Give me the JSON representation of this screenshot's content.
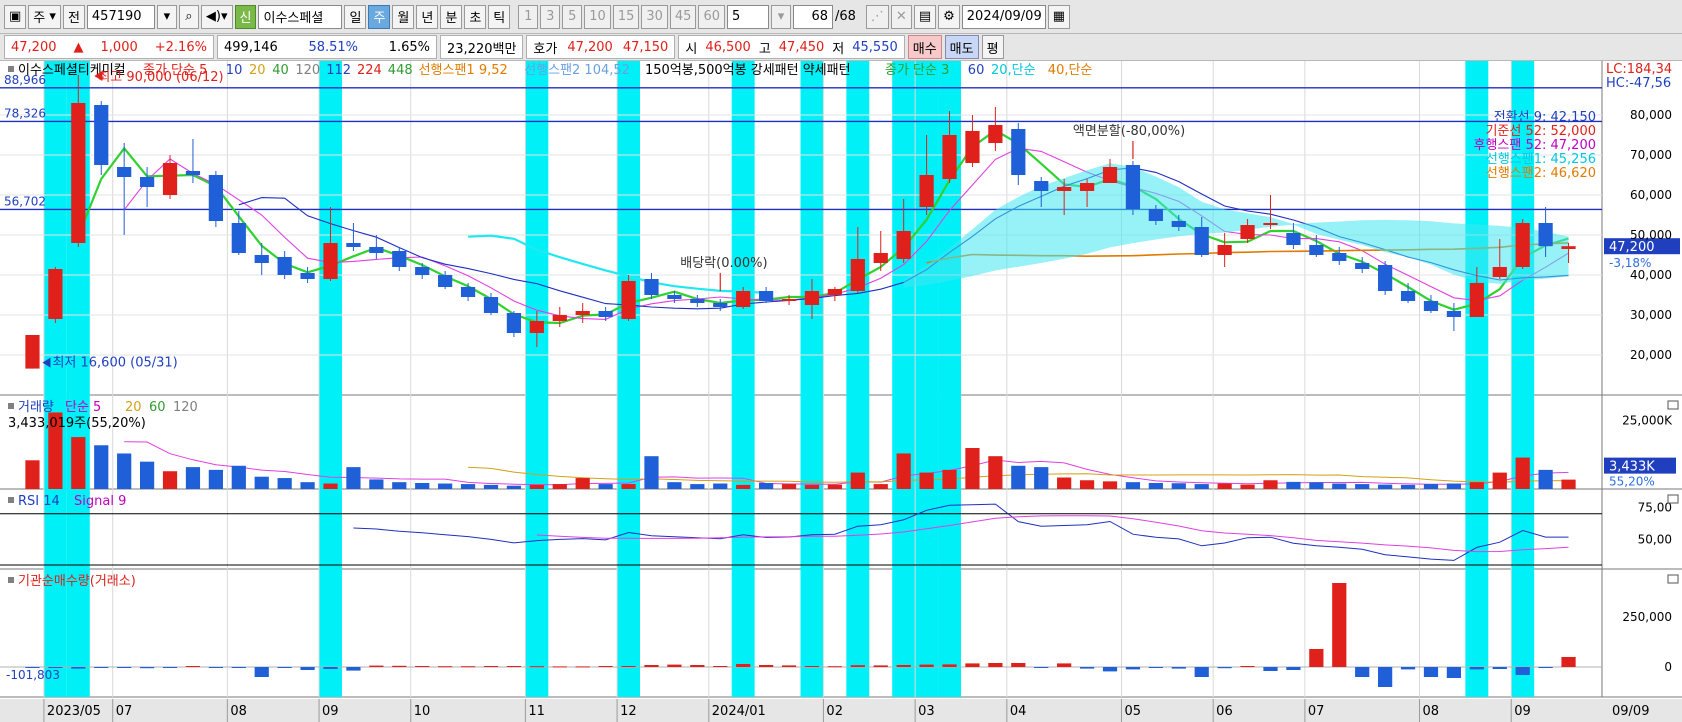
{
  "toolbar": {
    "type_select": "주",
    "prev_label": "전",
    "code": "457190",
    "search_icon": "search-icon",
    "sound_icon": "speaker-icon",
    "new_badge": "신",
    "stock_name": "이수스페셜",
    "periods": [
      "일",
      "주",
      "월",
      "년",
      "분",
      "초",
      "틱"
    ],
    "active_period": "주",
    "intervals": [
      "1",
      "3",
      "5",
      "10",
      "15",
      "30",
      "45",
      "60"
    ],
    "interval_select": "5",
    "count": "68",
    "count_total": "/68",
    "date": "2024/09/09",
    "calendar_icon": "calendar-icon"
  },
  "info": {
    "price": "47,200",
    "change_arrow": "▲",
    "change": "1,000",
    "change_pct": "+2.16%",
    "volume": "499,146",
    "volume_pct": "58.51%",
    "turnover": "1.65%",
    "amount": "23,220백만",
    "quote_label": "호가",
    "ask": "47,200",
    "bid": "47,150",
    "open_label": "시",
    "open": "46,500",
    "high_label": "고",
    "high": "47,450",
    "low_label": "저",
    "low": "45,550",
    "buy_label": "매수",
    "sell_label": "매도",
    "avg_label": "평"
  },
  "chart_data": {
    "type": "candlestick",
    "periodicity": "weekly",
    "price_axis": {
      "ylim": [
        12000,
        90000
      ],
      "ticks": [
        "80,000",
        "70,000",
        "60,000",
        "50,000",
        "40,000",
        "30,000",
        "20,000"
      ]
    },
    "price_legend": [
      {
        "text": "이수스페셜티케미컬",
        "color": "#000000"
      },
      {
        "text": "종가 단순 5",
        "color": "#e0201a"
      },
      {
        "text": "10",
        "color": "#1f3fbf"
      },
      {
        "text": "20",
        "color": "#d4a017"
      },
      {
        "text": "40",
        "color": "#2f9e2f"
      },
      {
        "text": "120",
        "color": "#808080"
      },
      {
        "text": "112",
        "color": "#1f3fbf"
      },
      {
        "text": "224",
        "color": "#e0201a"
      },
      {
        "text": "448",
        "color": "#2f9e2f"
      },
      {
        "text": "선행스팬1 9,52",
        "color": "#e07b00"
      },
      {
        "text": "선행스팬2 104,52",
        "color": "#6aa0e0"
      },
      {
        "text": "150억봉,500억봉 강세패턴  약세패턴",
        "color": "#000000"
      },
      {
        "text": "종가 단순 3",
        "color": "#2f9e2f"
      },
      {
        "text": "60",
        "color": "#1f3fbf"
      },
      {
        "text": "20,단순",
        "color": "#00c8e0"
      },
      {
        "text": "40,단순",
        "color": "#e07b00"
      }
    ],
    "hlines": [
      {
        "label": "88,966",
        "value": 86800
      },
      {
        "label": "78,326",
        "value": 78400
      },
      {
        "label": "56,702",
        "value": 56400
      }
    ],
    "annotations": {
      "high": "최고 90,000 (06/12)",
      "low": "최저 16,600 (05/31)",
      "dividend": "배당락(0.00%)",
      "split": "액면분할(-80,00%)"
    },
    "top_right_labels": {
      "lc": "LC:184,34",
      "hc": "HC:-47,56"
    },
    "right_side_labels": [
      {
        "text": "전환선 9: 42,150",
        "color": "#1f3fbf"
      },
      {
        "text": "기준선 52: 52,000",
        "color": "#e0201a"
      },
      {
        "text": "후행스팬 52: 47,200",
        "color": "#c000c0"
      },
      {
        "text": "선행스팬1: 45,256",
        "color": "#00c8e0"
      },
      {
        "text": "선행스팬2: 46,620",
        "color": "#e07b00"
      }
    ],
    "current_price_tag": "47,200",
    "current_change_tag": "-3,18%",
    "x_axis_labels": [
      {
        "label": "2023/05",
        "i": 1
      },
      {
        "label": "07",
        "i": 4
      },
      {
        "label": "08",
        "i": 9
      },
      {
        "label": "09",
        "i": 13
      },
      {
        "label": "10",
        "i": 17
      },
      {
        "label": "11",
        "i": 22
      },
      {
        "label": "12",
        "i": 26
      },
      {
        "label": "2024/01",
        "i": 30
      },
      {
        "label": "02",
        "i": 35
      },
      {
        "label": "03",
        "i": 39
      },
      {
        "label": "04",
        "i": 43
      },
      {
        "label": "05",
        "i": 48
      },
      {
        "label": "06",
        "i": 52
      },
      {
        "label": "07",
        "i": 56
      },
      {
        "label": "08",
        "i": 61
      },
      {
        "label": "09",
        "i": 65
      }
    ],
    "x_axis_end_label": "09/09",
    "highlight_weeks": [
      1,
      2,
      13,
      22,
      26,
      31,
      34,
      36,
      38,
      39,
      40,
      63,
      65
    ],
    "candles": [
      {
        "o": 16600,
        "h": 25000,
        "l": 16600,
        "c": 25000
      },
      {
        "o": 29000,
        "h": 42000,
        "l": 28000,
        "c": 41500
      },
      {
        "o": 48000,
        "h": 90000,
        "l": 47000,
        "c": 83000
      },
      {
        "o": 82500,
        "h": 83500,
        "l": 65000,
        "c": 67500
      },
      {
        "o": 67000,
        "h": 73000,
        "l": 50000,
        "c": 64500
      },
      {
        "o": 64500,
        "h": 67000,
        "l": 57000,
        "c": 62000
      },
      {
        "o": 60000,
        "h": 70000,
        "l": 59000,
        "c": 68000
      },
      {
        "o": 66000,
        "h": 74000,
        "l": 63000,
        "c": 65000
      },
      {
        "o": 65000,
        "h": 66000,
        "l": 52000,
        "c": 53500
      },
      {
        "o": 53000,
        "h": 56000,
        "l": 45000,
        "c": 45500
      },
      {
        "o": 45000,
        "h": 48000,
        "l": 40000,
        "c": 43000
      },
      {
        "o": 44500,
        "h": 46000,
        "l": 39000,
        "c": 40000
      },
      {
        "o": 40500,
        "h": 42000,
        "l": 38000,
        "c": 39000
      },
      {
        "o": 39000,
        "h": 57000,
        "l": 38500,
        "c": 48000
      },
      {
        "o": 48000,
        "h": 53000,
        "l": 46000,
        "c": 47000
      },
      {
        "o": 47000,
        "h": 50000,
        "l": 44000,
        "c": 45500
      },
      {
        "o": 46000,
        "h": 47000,
        "l": 41000,
        "c": 42000
      },
      {
        "o": 42000,
        "h": 43000,
        "l": 39000,
        "c": 40000
      },
      {
        "o": 40000,
        "h": 41000,
        "l": 36500,
        "c": 37000
      },
      {
        "o": 37000,
        "h": 38000,
        "l": 33500,
        "c": 34500
      },
      {
        "o": 34500,
        "h": 35500,
        "l": 30000,
        "c": 30500
      },
      {
        "o": 30500,
        "h": 31000,
        "l": 24500,
        "c": 25500
      },
      {
        "o": 25500,
        "h": 31000,
        "l": 22000,
        "c": 28500
      },
      {
        "o": 28500,
        "h": 32000,
        "l": 27000,
        "c": 30000
      },
      {
        "o": 30000,
        "h": 33000,
        "l": 28000,
        "c": 31000
      },
      {
        "o": 31000,
        "h": 32000,
        "l": 28500,
        "c": 29500
      },
      {
        "o": 29000,
        "h": 40000,
        "l": 28500,
        "c": 38500
      },
      {
        "o": 39000,
        "h": 40500,
        "l": 34000,
        "c": 35000
      },
      {
        "o": 35000,
        "h": 36000,
        "l": 33000,
        "c": 34000
      },
      {
        "o": 34000,
        "h": 35000,
        "l": 32000,
        "c": 33000
      },
      {
        "o": 33000,
        "h": 34000,
        "l": 31000,
        "c": 32000
      },
      {
        "o": 32000,
        "h": 37000,
        "l": 31500,
        "c": 36000
      },
      {
        "o": 36000,
        "h": 37000,
        "l": 33000,
        "c": 33500
      },
      {
        "o": 33500,
        "h": 35000,
        "l": 32500,
        "c": 34000
      },
      {
        "o": 32500,
        "h": 39000,
        "l": 29000,
        "c": 36000
      },
      {
        "o": 35000,
        "h": 37000,
        "l": 33500,
        "c": 36500
      },
      {
        "o": 36000,
        "h": 52000,
        "l": 35500,
        "c": 44000
      },
      {
        "o": 43000,
        "h": 51000,
        "l": 41000,
        "c": 45500
      },
      {
        "o": 44000,
        "h": 59000,
        "l": 43000,
        "c": 51000
      },
      {
        "o": 57000,
        "h": 75000,
        "l": 55000,
        "c": 65000
      },
      {
        "o": 64000,
        "h": 81000,
        "l": 63000,
        "c": 75000
      },
      {
        "o": 68000,
        "h": 80000,
        "l": 67000,
        "c": 76000
      },
      {
        "o": 73000,
        "h": 82000,
        "l": 71000,
        "c": 77500
      },
      {
        "o": 76500,
        "h": 78000,
        "l": 62500,
        "c": 65000
      },
      {
        "o": 63500,
        "h": 64500,
        "l": 57000,
        "c": 61000
      },
      {
        "o": 61000,
        "h": 64000,
        "l": 55000,
        "c": 62000
      },
      {
        "o": 61000,
        "h": 64000,
        "l": 57000,
        "c": 63000
      },
      {
        "o": 63000,
        "h": 69000,
        "l": 63000,
        "c": 67000
      },
      {
        "o": 67500,
        "h": 68500,
        "l": 55000,
        "c": 56500
      },
      {
        "o": 56500,
        "h": 57500,
        "l": 52500,
        "c": 53500
      },
      {
        "o": 53500,
        "h": 55000,
        "l": 51000,
        "c": 52000
      },
      {
        "o": 52000,
        "h": 54500,
        "l": 44500,
        "c": 45000
      },
      {
        "o": 45000,
        "h": 50500,
        "l": 42000,
        "c": 47500
      },
      {
        "o": 49000,
        "h": 54000,
        "l": 48000,
        "c": 52500
      },
      {
        "o": 52500,
        "h": 60000,
        "l": 51500,
        "c": 53000
      },
      {
        "o": 50500,
        "h": 53000,
        "l": 46500,
        "c": 47500
      },
      {
        "o": 47500,
        "h": 50000,
        "l": 44500,
        "c": 45000
      },
      {
        "o": 45500,
        "h": 47000,
        "l": 42500,
        "c": 43500
      },
      {
        "o": 43000,
        "h": 44500,
        "l": 40500,
        "c": 41500
      },
      {
        "o": 42500,
        "h": 43500,
        "l": 35000,
        "c": 36000
      },
      {
        "o": 36000,
        "h": 38000,
        "l": 33000,
        "c": 33500
      },
      {
        "o": 33500,
        "h": 35000,
        "l": 30500,
        "c": 31000
      },
      {
        "o": 31000,
        "h": 33000,
        "l": 26000,
        "c": 29500
      },
      {
        "o": 29500,
        "h": 42000,
        "l": 29500,
        "c": 38000
      },
      {
        "o": 39500,
        "h": 49000,
        "l": 39000,
        "c": 42000
      },
      {
        "o": 42000,
        "h": 54000,
        "l": 41500,
        "c": 53000
      },
      {
        "o": 53000,
        "h": 57000,
        "l": 44500,
        "c": 47200
      },
      {
        "o": 46500,
        "h": 48000,
        "l": 43000,
        "c": 47200
      }
    ],
    "volume_panel": {
      "legend": [
        {
          "text": "거래량",
          "color": "#1f3fbf"
        },
        {
          "text": "단순 5",
          "color": "#c000c0"
        },
        {
          "text": "20",
          "color": "#d4a017"
        },
        {
          "text": "60",
          "color": "#2f9e2f"
        },
        {
          "text": "120",
          "color": "#808080"
        }
      ],
      "annotation": "3,433,019주(55,20%)",
      "ylim": [
        0,
        30000
      ],
      "ticks": [
        "25,000K"
      ],
      "current_tag": "3,433K",
      "current_pct_tag": "55,20%",
      "values": [
        10500,
        28000,
        19000,
        16000,
        13000,
        10000,
        6500,
        8000,
        7000,
        8500,
        4500,
        4000,
        2500,
        2000,
        8000,
        3500,
        2500,
        2200,
        2000,
        1800,
        1500,
        1200,
        1500,
        1800,
        4000,
        1800,
        1800,
        12000,
        2500,
        1800,
        2000,
        1500,
        2200,
        1800,
        1500,
        1600,
        6000,
        1800,
        13000,
        6000,
        7000,
        15000,
        12000,
        8500,
        8000,
        4200,
        3200,
        2800,
        2500,
        2200,
        2100,
        1800,
        2000,
        1600,
        3200,
        2600,
        2400,
        2000,
        1800,
        1600,
        1500,
        1800,
        2000,
        2500,
        6000,
        11500,
        7000,
        3433
      ]
    },
    "rsi_panel": {
      "legend": [
        {
          "text": "RSI 14",
          "color": "#1f3fbf"
        },
        {
          "text": "Signal 9",
          "color": "#c000c0"
        }
      ],
      "ylim": [
        30,
        80
      ],
      "ticks": [
        "75,00",
        "50,00"
      ],
      "overbought": 70,
      "oversold": 30
    },
    "inst_panel": {
      "legend": [
        {
          "text": "기관순매수량(거래소)",
          "color": "#e0201a"
        }
      ],
      "ylim": [
        -120000,
        420000
      ],
      "ticks": [
        "250,000",
        "0"
      ],
      "annotation": "-101,803",
      "values": [
        -5000,
        -3000,
        -8000,
        -4000,
        -5000,
        -6000,
        -4000,
        5000,
        -5000,
        -3000,
        -50000,
        -3000,
        -15000,
        -10000,
        -18000,
        7000,
        6000,
        5000,
        4000,
        4000,
        5000,
        5000,
        4000,
        3000,
        3000,
        5000,
        5000,
        10000,
        12000,
        10000,
        5000,
        15000,
        10000,
        8000,
        5000,
        4000,
        9000,
        8000,
        10000,
        12000,
        13000,
        18000,
        20000,
        20000,
        -5000,
        18000,
        -8000,
        -22000,
        -12000,
        -5000,
        -8000,
        -50000,
        -6000,
        5000,
        -20000,
        -15000,
        90000,
        420000,
        -50000,
        -100000,
        -12000,
        -50000,
        -55000,
        -12000,
        -10000,
        -40000,
        -5000,
        50000,
        195000,
        70000,
        60000
      ]
    }
  }
}
